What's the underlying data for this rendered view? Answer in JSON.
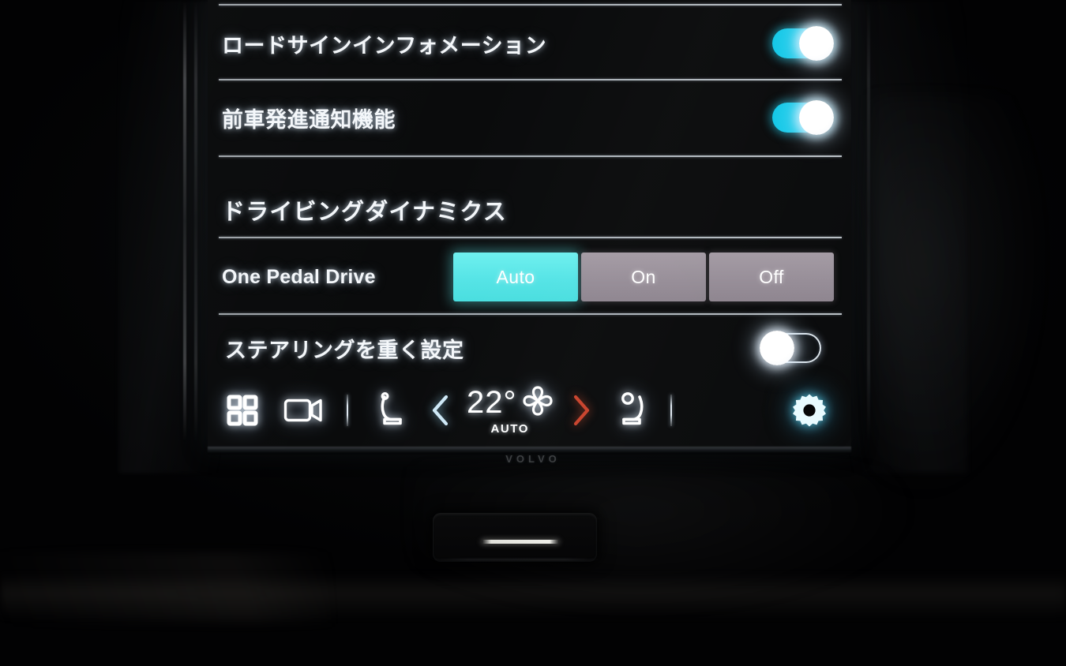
{
  "display": {
    "settings_rows": [
      {
        "id": "road-sign-information",
        "label": "ロードサインインフォメーション",
        "control": "toggle",
        "state": "on"
      },
      {
        "id": "forward-vehicle-start-notification",
        "label": "前車発進通知機能",
        "control": "toggle",
        "state": "on"
      }
    ],
    "section_heading": "ドライビングダイナミクス",
    "one_pedal_drive": {
      "label": "One Pedal Drive",
      "options": [
        "Auto",
        "On",
        "Off"
      ],
      "selected": "Auto"
    },
    "steering_row": {
      "id": "heavier-steering",
      "label": "ステアリングを重く設定",
      "control": "toggle",
      "state": "off"
    }
  },
  "climate_bar": {
    "apps_icon": "apps-grid-icon",
    "camera_icon": "camera-icon",
    "driver_seat_icon": "driver-seat-icon",
    "decrease_icon": "chevron-left-icon",
    "temperature": "22°",
    "fan_icon": "fan-icon",
    "auto_label": "AUTO",
    "increase_icon": "chevron-right-icon",
    "passenger_seat_icon": "passenger-seat-icon",
    "settings_icon": "gear-icon"
  },
  "hardware": {
    "brand_wordmark": "VOLVO"
  },
  "colors": {
    "accent_cyan": "#22cde8",
    "segment_selected": "#55e4e6",
    "segment_unselected": "#968d97",
    "chevron_left": "#9fd8f0",
    "chevron_right": "#c8432c",
    "gear_cyan": "#79e0f5",
    "screen_background": "#0a0b0c",
    "divider": "#d4dce4",
    "text_primary": "#f4f7fa"
  }
}
